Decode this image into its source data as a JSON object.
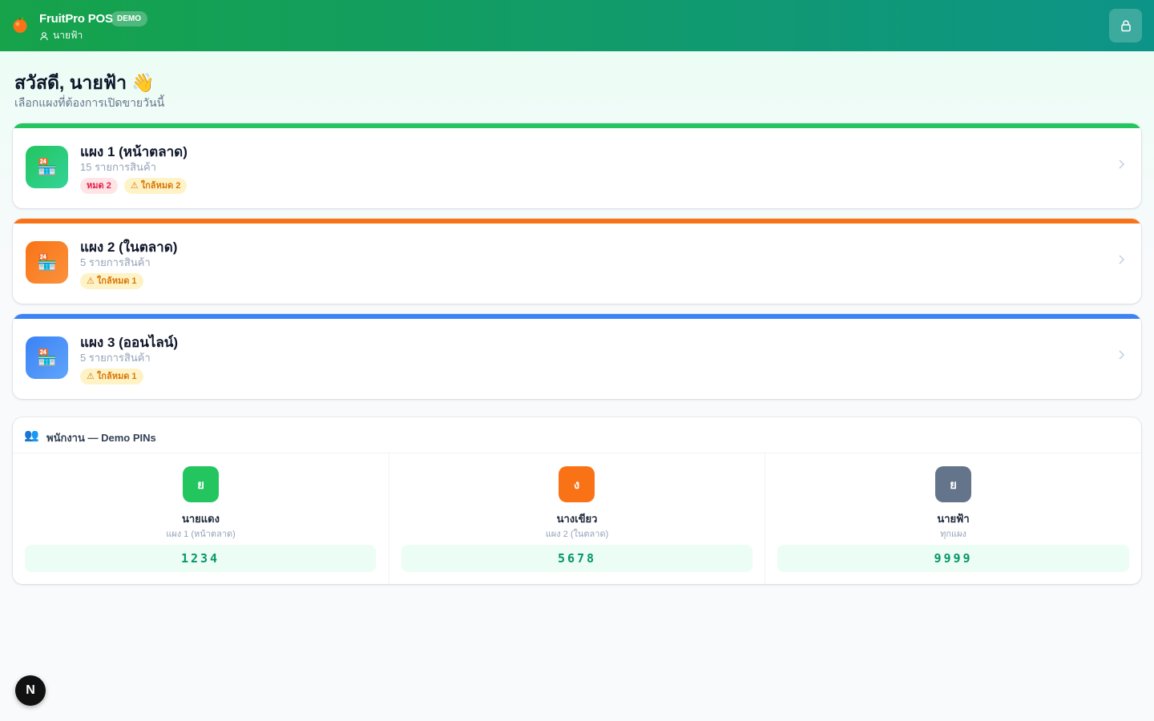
{
  "header": {
    "logo_icon": "orange-fruit-icon",
    "app_title": "FruitPro POS",
    "demo_badge": "DEMO",
    "user_name": "นายฟ้า",
    "lock_icon": "lock-icon"
  },
  "greeting": {
    "title": "สวัสดี, นายฟ้า 👋",
    "subtitle": "เลือกแผงที่ต้องการเปิดขายวันนี้"
  },
  "stalls": [
    {
      "name": "แผง 1 (หน้าตลาด)",
      "count": "15 รายการสินค้า",
      "color": "#22c55e",
      "icon": "store-icon",
      "badge_out": "หมด 2",
      "badge_low": "⚠ ใกล้หมด 2"
    },
    {
      "name": "แผง 2 (ในตลาด)",
      "count": "5 รายการสินค้า",
      "color": "#f97316",
      "icon": "store-icon",
      "badge_low": "⚠ ใกล้หมด 1"
    },
    {
      "name": "แผง 3 (ออนไลน์)",
      "count": "5 รายการสินค้า",
      "color": "#3b82f6",
      "icon": "store-icon",
      "badge_low": "⚠ ใกล้หมด 1"
    }
  ],
  "staff": {
    "title": "พนักงาน — Demo PINs",
    "icon": "people-icon",
    "members": [
      {
        "initial": "ย",
        "name": "นายแดง",
        "role": "แผง 1 (หน้าตลาด)",
        "pin": "1234",
        "color": "#22c55e"
      },
      {
        "initial": "ง",
        "name": "นางเขียว",
        "role": "แผง 2 (ในตลาด)",
        "pin": "5678",
        "color": "#f97316"
      },
      {
        "initial": "ย",
        "name": "นายฟ้า",
        "role": "ทุกแผง",
        "pin": "9999",
        "color": "#64748b"
      }
    ]
  },
  "dev_badge": "N"
}
